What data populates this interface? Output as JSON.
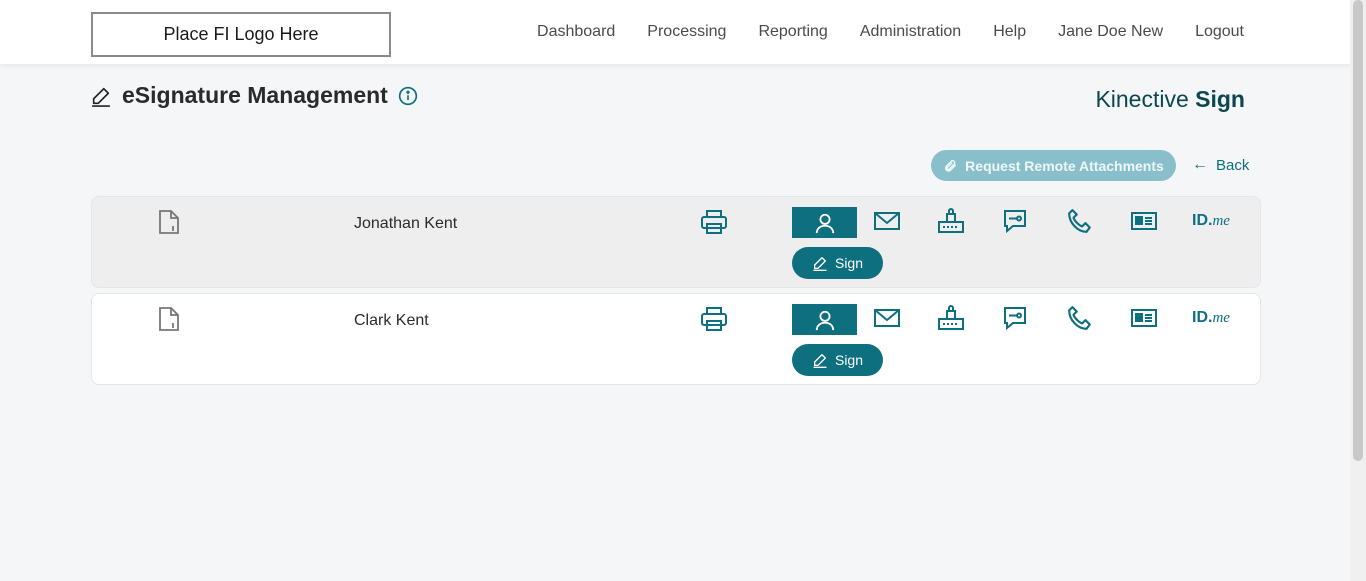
{
  "header": {
    "logo_text": "Place FI Logo Here",
    "nav": [
      "Dashboard",
      "Processing",
      "Reporting",
      "Administration",
      "Help",
      "Jane Doe New",
      "Logout"
    ]
  },
  "page": {
    "title": "eSignature Management",
    "brand_light": "Kinective ",
    "brand_bold": "Sign"
  },
  "actions": {
    "request_label": "Request Remote Attachments",
    "back_label": "Back"
  },
  "signers": [
    {
      "name": "Jonathan Kent",
      "sign_label": "Sign",
      "idme_id": "ID.",
      "idme_me": "me"
    },
    {
      "name": "Clark Kent",
      "sign_label": "Sign",
      "idme_id": "ID.",
      "idme_me": "me"
    }
  ],
  "colors": {
    "accent": "#0e6f7f",
    "accent_light": "#89bfca",
    "brand_text": "#0c4650",
    "row_shaded": "#eeeeef"
  }
}
